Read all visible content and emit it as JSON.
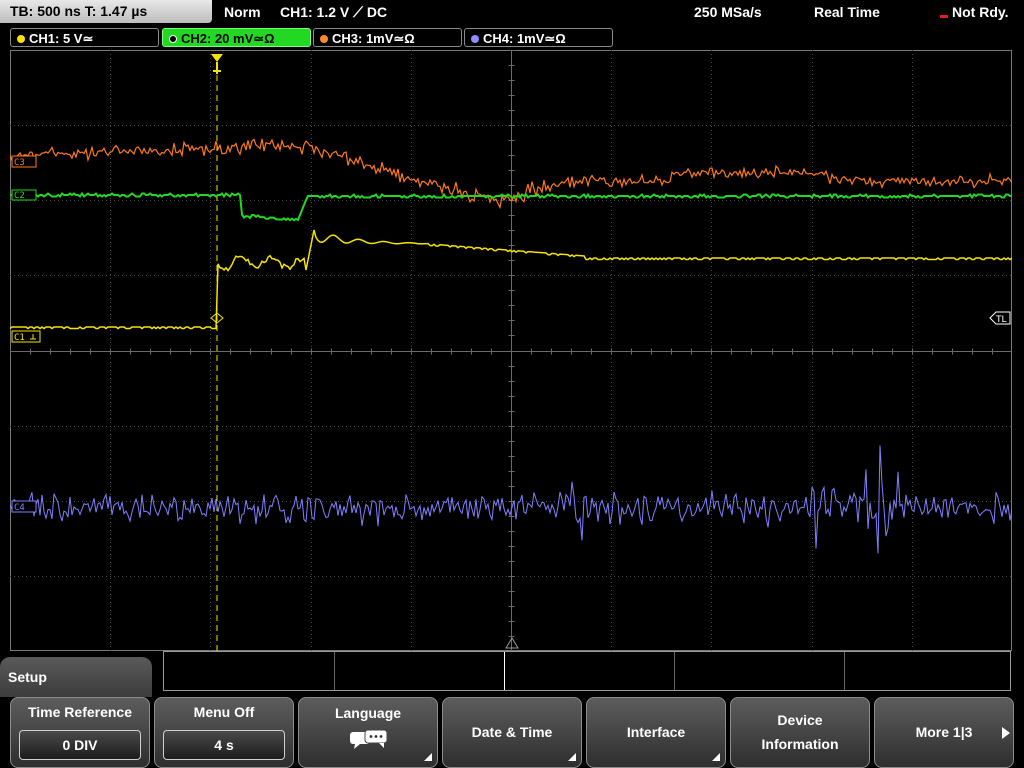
{
  "status": {
    "timebase": "TB: 500 ns   T: 1.47 µs",
    "mode": "Norm",
    "trigger": "CH1: 1.2 V ⟋ DC",
    "sample_rate": "250 MSa/s",
    "acq": "Real Time",
    "state": "Not Rdy."
  },
  "channels": [
    {
      "label": "CH1: 5 V≃",
      "color": "#f5e400"
    },
    {
      "label": "CH2: 20 mV≃Ω",
      "color": "#22d822"
    },
    {
      "label": "CH3: 1mV≃Ω",
      "color": "#ff8a2a"
    },
    {
      "label": "CH4: 1mV≃Ω",
      "color": "#8c8cff"
    }
  ],
  "markers": {
    "ch1": "C1",
    "ch2": "C2",
    "ch3": "C3",
    "ch4": "C4",
    "trigger_level": "TL"
  },
  "colors": {
    "ch1": "#f5e400",
    "ch2": "#22d822",
    "ch3": "#ff7a1a",
    "ch4": "#8080ff",
    "grid": "#5a5a5a"
  },
  "menu": {
    "title": "Setup",
    "keys": [
      {
        "label": "Time Reference",
        "value": "0 DIV"
      },
      {
        "label": "Menu Off",
        "value": "4 s"
      },
      {
        "label": "Language",
        "icon": "speech-bubbles-icon"
      },
      {
        "label": "Date & Time"
      },
      {
        "label": "Interface"
      },
      {
        "label1": "Device",
        "label2": "Information"
      },
      {
        "label": "More 1|3"
      }
    ]
  }
}
